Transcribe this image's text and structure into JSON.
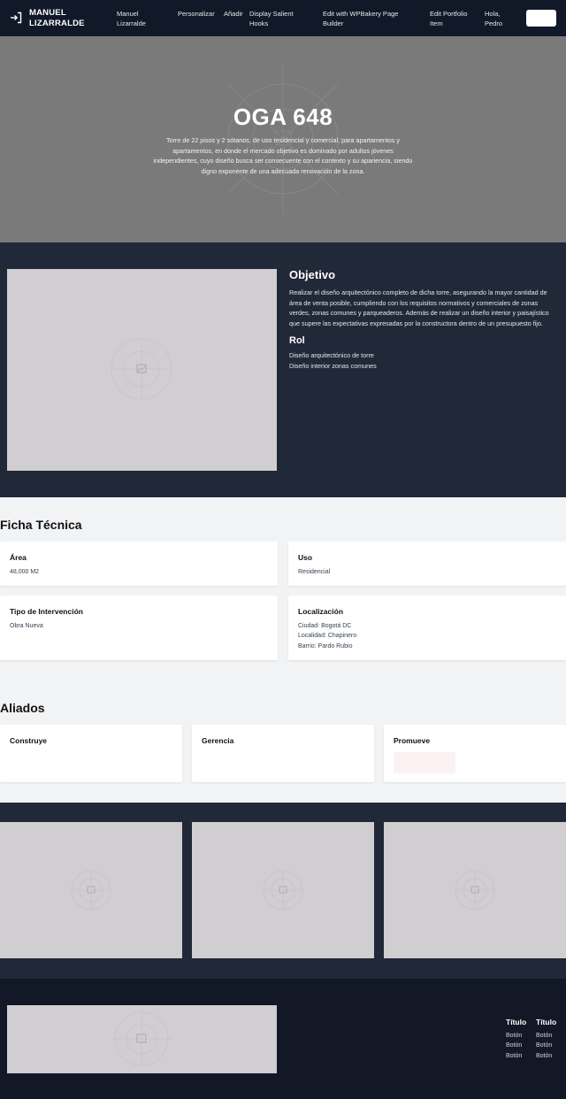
{
  "header": {
    "brand": "MANUEL LIZARRALDE",
    "nav": [
      "Manuel Lizarralde",
      "Personalizar",
      "Añadir",
      "Display Salient Hooks",
      "Edit with WPBakery Page Builder",
      "Edit Portfolio Item",
      "Hola, Pedro"
    ]
  },
  "hero": {
    "title": "OGA 648",
    "description": "Torre de 22 pisos y 2 sótanos, de uso residencial y comercial, para apartamentos y apartamentos, en donde el mercado objetivo es dominado por adultos jóvenes independientes, cuyo diseño busca ser consecuente con el contexto y su apariencia, siendo digno exponente de una adecuada renovación de la zona."
  },
  "objective": {
    "heading": "Objetivo",
    "text": "Realizar el diseño arquitectónico completo de dicha torre, asegurando la mayor cantidad de área de venta posible, cumpliendo con los requisitos normativos y comerciales de zonas verdes, zonas comunes y parqueaderos. Además de realizar un diseño interior y paisajístico que supere las expectativas expresadas por la constructora dentro de un presupuesto fijo.",
    "rol_heading": "Rol",
    "rol_items": [
      "Diseño arquitectónico de torre",
      "Diseño interior zonas comunes"
    ]
  },
  "ficha": {
    "title": "Ficha Técnica",
    "cards": [
      {
        "title": "Área",
        "lines": [
          "48,000 M2"
        ]
      },
      {
        "title": "Uso",
        "lines": [
          "Residencial"
        ]
      },
      {
        "title": "Tipo de Intervención",
        "lines": [
          "Obra Nueva"
        ]
      },
      {
        "title": "Localización",
        "lines": [
          "Ciudad: Bogotá DC",
          "Localidad: Chapinero",
          "Barrio: Pardo Rubio"
        ]
      }
    ]
  },
  "aliados": {
    "title": "Aliados",
    "cards": [
      "Construye",
      "Gerencia",
      "Promueve"
    ]
  },
  "footer": {
    "columns": [
      {
        "title": "Título",
        "links": [
          "Botón",
          "Botón",
          "Botón"
        ]
      },
      {
        "title": "Título",
        "links": [
          "Botón",
          "Botón",
          "Botón"
        ]
      }
    ]
  },
  "colors": {
    "topbar": "#111827",
    "dark_section": "#212838",
    "footer": "#131827",
    "page_bg": "#f2f3f5",
    "placeholder": "#d1ced1"
  }
}
